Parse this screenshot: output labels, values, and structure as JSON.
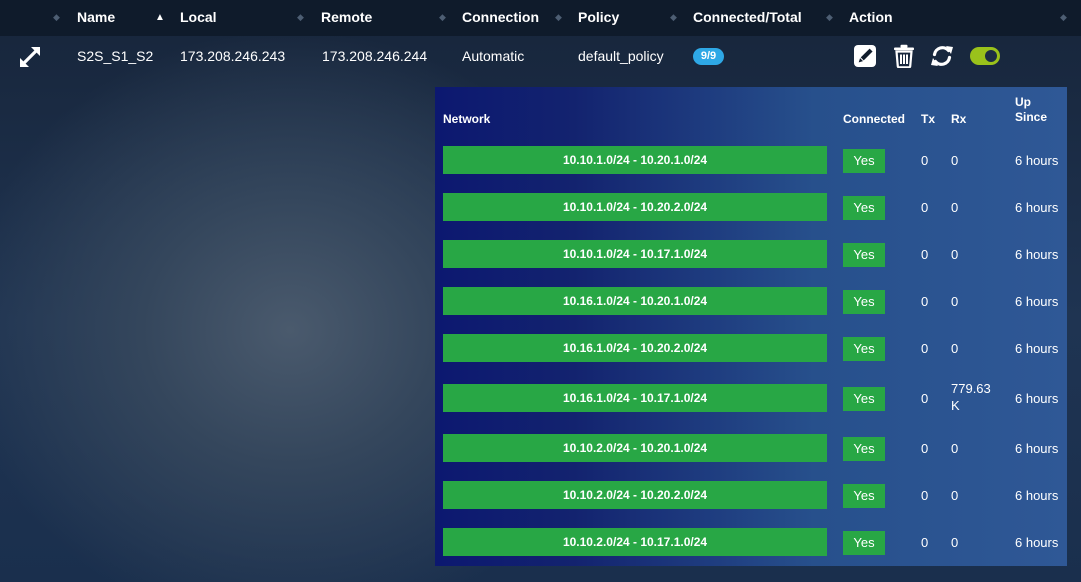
{
  "columns": {
    "name": "Name",
    "local": "Local",
    "remote": "Remote",
    "connection": "Connection",
    "policy": "Policy",
    "connected_total": "Connected/Total",
    "action": "Action"
  },
  "tunnel": {
    "name": "S2S_S1_S2",
    "local": "173.208.246.243",
    "remote": "173.208.246.244",
    "connection": "Automatic",
    "policy": "default_policy",
    "connected_total": "9/9",
    "enabled": true
  },
  "detail": {
    "headers": {
      "network": "Network",
      "connected": "Connected",
      "tx": "Tx",
      "rx": "Rx",
      "up_since_line1": "Up",
      "up_since_line2": "Since"
    },
    "rows": [
      {
        "network": "10.10.1.0/24 - 10.20.1.0/24",
        "connected": "Yes",
        "tx": "0",
        "rx": "0",
        "up_since": "6 hours"
      },
      {
        "network": "10.10.1.0/24 - 10.20.2.0/24",
        "connected": "Yes",
        "tx": "0",
        "rx": "0",
        "up_since": "6 hours"
      },
      {
        "network": "10.10.1.0/24 - 10.17.1.0/24",
        "connected": "Yes",
        "tx": "0",
        "rx": "0",
        "up_since": "6 hours"
      },
      {
        "network": "10.16.1.0/24 - 10.20.1.0/24",
        "connected": "Yes",
        "tx": "0",
        "rx": "0",
        "up_since": "6 hours"
      },
      {
        "network": "10.16.1.0/24 - 10.20.2.0/24",
        "connected": "Yes",
        "tx": "0",
        "rx": "0",
        "up_since": "6 hours"
      },
      {
        "network": "10.16.1.0/24 - 10.17.1.0/24",
        "connected": "Yes",
        "tx": "0",
        "rx_line1": "779.63",
        "rx_line2": "K",
        "up_since": "6 hours"
      },
      {
        "network": "10.10.2.0/24 - 10.20.1.0/24",
        "connected": "Yes",
        "tx": "0",
        "rx": "0",
        "up_since": "6 hours"
      },
      {
        "network": "10.10.2.0/24 - 10.20.2.0/24",
        "connected": "Yes",
        "tx": "0",
        "rx": "0",
        "up_since": "6 hours"
      },
      {
        "network": "10.10.2.0/24 - 10.17.1.0/24",
        "connected": "Yes",
        "tx": "0",
        "rx": "0",
        "up_since": "6 hours"
      }
    ]
  },
  "icons": {
    "expand": "expand-arrows-icon",
    "edit": "edit-icon",
    "delete": "trash-icon",
    "refresh": "refresh-icon",
    "toggle": "toggle-switch"
  },
  "colors": {
    "header_bg": "#0f1b2b",
    "success": "#28a745",
    "badge": "#2ea8e6",
    "toggle_on": "#9ac21b"
  }
}
